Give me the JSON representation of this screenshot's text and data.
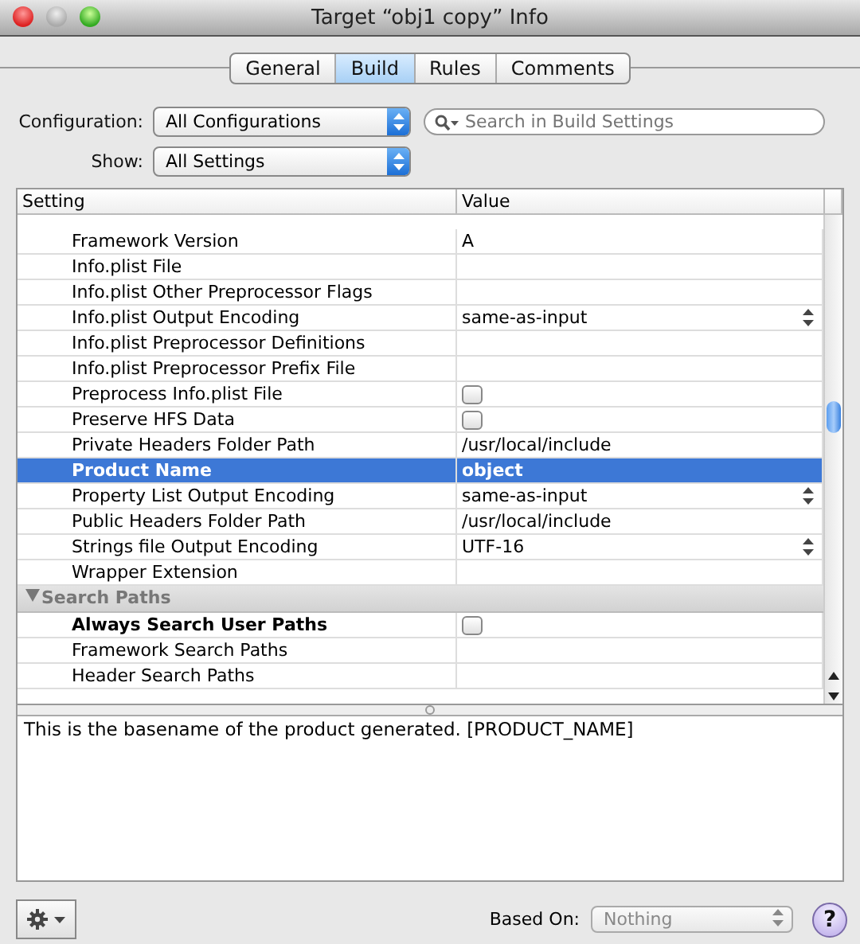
{
  "window": {
    "title": "Target “obj1 copy” Info"
  },
  "tabs": [
    {
      "label": "General",
      "selected": false
    },
    {
      "label": "Build",
      "selected": true
    },
    {
      "label": "Rules",
      "selected": false
    },
    {
      "label": "Comments",
      "selected": false
    }
  ],
  "configuration": {
    "label": "Configuration:",
    "value": "All Configurations"
  },
  "show": {
    "label": "Show:",
    "value": "All Settings"
  },
  "search": {
    "placeholder": "Search in Build Settings"
  },
  "table": {
    "columns": [
      "Setting",
      "Value"
    ],
    "rows": [
      {
        "kind": "text",
        "setting": "Framework Version",
        "value": "A",
        "customized": false,
        "selected": false
      },
      {
        "kind": "text",
        "setting": "Info.plist File",
        "value": "",
        "customized": false,
        "selected": false
      },
      {
        "kind": "text",
        "setting": "Info.plist Other Preprocessor Flags",
        "value": "",
        "customized": false,
        "selected": false
      },
      {
        "kind": "popup",
        "setting": "Info.plist Output Encoding",
        "value": "same-as-input",
        "customized": false,
        "selected": false
      },
      {
        "kind": "text",
        "setting": "Info.plist Preprocessor Definitions",
        "value": "",
        "customized": false,
        "selected": false
      },
      {
        "kind": "text",
        "setting": "Info.plist Preprocessor Prefix File",
        "value": "",
        "customized": false,
        "selected": false
      },
      {
        "kind": "checkbox",
        "setting": "Preprocess Info.plist File",
        "checked": false,
        "customized": false,
        "selected": false
      },
      {
        "kind": "checkbox",
        "setting": "Preserve HFS Data",
        "checked": false,
        "customized": false,
        "selected": false
      },
      {
        "kind": "text",
        "setting": "Private Headers Folder Path",
        "value": "/usr/local/include",
        "customized": false,
        "selected": false
      },
      {
        "kind": "text",
        "setting": "Product Name",
        "value": "object",
        "customized": true,
        "selected": true
      },
      {
        "kind": "popup",
        "setting": "Property List Output Encoding",
        "value": "same-as-input",
        "customized": false,
        "selected": false
      },
      {
        "kind": "text",
        "setting": "Public Headers Folder Path",
        "value": "/usr/local/include",
        "customized": false,
        "selected": false
      },
      {
        "kind": "popup",
        "setting": "Strings file Output Encoding",
        "value": "UTF-16",
        "customized": false,
        "selected": false
      },
      {
        "kind": "text",
        "setting": "Wrapper Extension",
        "value": "",
        "customized": false,
        "selected": false
      },
      {
        "kind": "group",
        "setting": "Search Paths",
        "expanded": true,
        "selected": false
      },
      {
        "kind": "checkbox",
        "setting": "Always Search User Paths",
        "checked": false,
        "customized": true,
        "selected": false
      },
      {
        "kind": "text",
        "setting": "Framework Search Paths",
        "value": "",
        "customized": false,
        "selected": false
      },
      {
        "kind": "text",
        "setting": "Header Search Paths",
        "value": "",
        "customized": false,
        "selected": false
      }
    ]
  },
  "description": "This is the basename of the product generated. [PRODUCT_NAME]",
  "based_on": {
    "label": "Based On:",
    "value": "Nothing",
    "disabled": true
  },
  "help": {
    "label": "?"
  }
}
